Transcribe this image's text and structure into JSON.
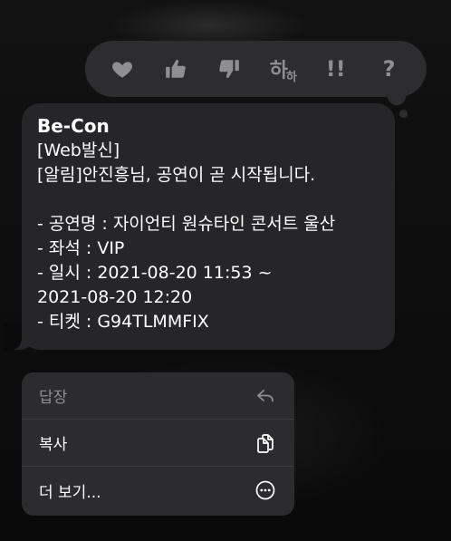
{
  "tapback": {
    "items": [
      {
        "icon": "heart-icon"
      },
      {
        "icon": "thumbs-up-icon"
      },
      {
        "icon": "thumbs-down-icon"
      },
      {
        "icon": "haha-icon",
        "main": "하",
        "sub": "하"
      },
      {
        "icon": "double-exclamation-icon",
        "text": "!!"
      },
      {
        "icon": "question-mark-icon",
        "text": "?"
      }
    ]
  },
  "message": {
    "sender": "Be-Con",
    "lines": [
      "[Web발신]",
      "[알림]안진흥님, 공연이 곧 시작됩니다.",
      "",
      "- 공연명 : 자이언티 원슈타인 콘서트 울산",
      "- 좌석 : VIP",
      "- 일시 : 2021-08-20 11:53 ~",
      "2021-08-20 12:20",
      "- 티켓 : G94TLMMFIX"
    ]
  },
  "menu": {
    "items": [
      {
        "label": "답장",
        "icon": "reply-arrow-icon",
        "dim": true
      },
      {
        "label": "복사",
        "icon": "copy-icon",
        "dim": false
      },
      {
        "label": "더 보기...",
        "icon": "more-ellipsis-icon",
        "dim": false
      }
    ]
  },
  "colors": {
    "background": "#0b0b0b",
    "bubble": "#262628",
    "tapback_bar": "#2d2d2f",
    "menu": "#2c2c2e",
    "icon_gray": "#8e8e93",
    "text": "#ffffff"
  }
}
